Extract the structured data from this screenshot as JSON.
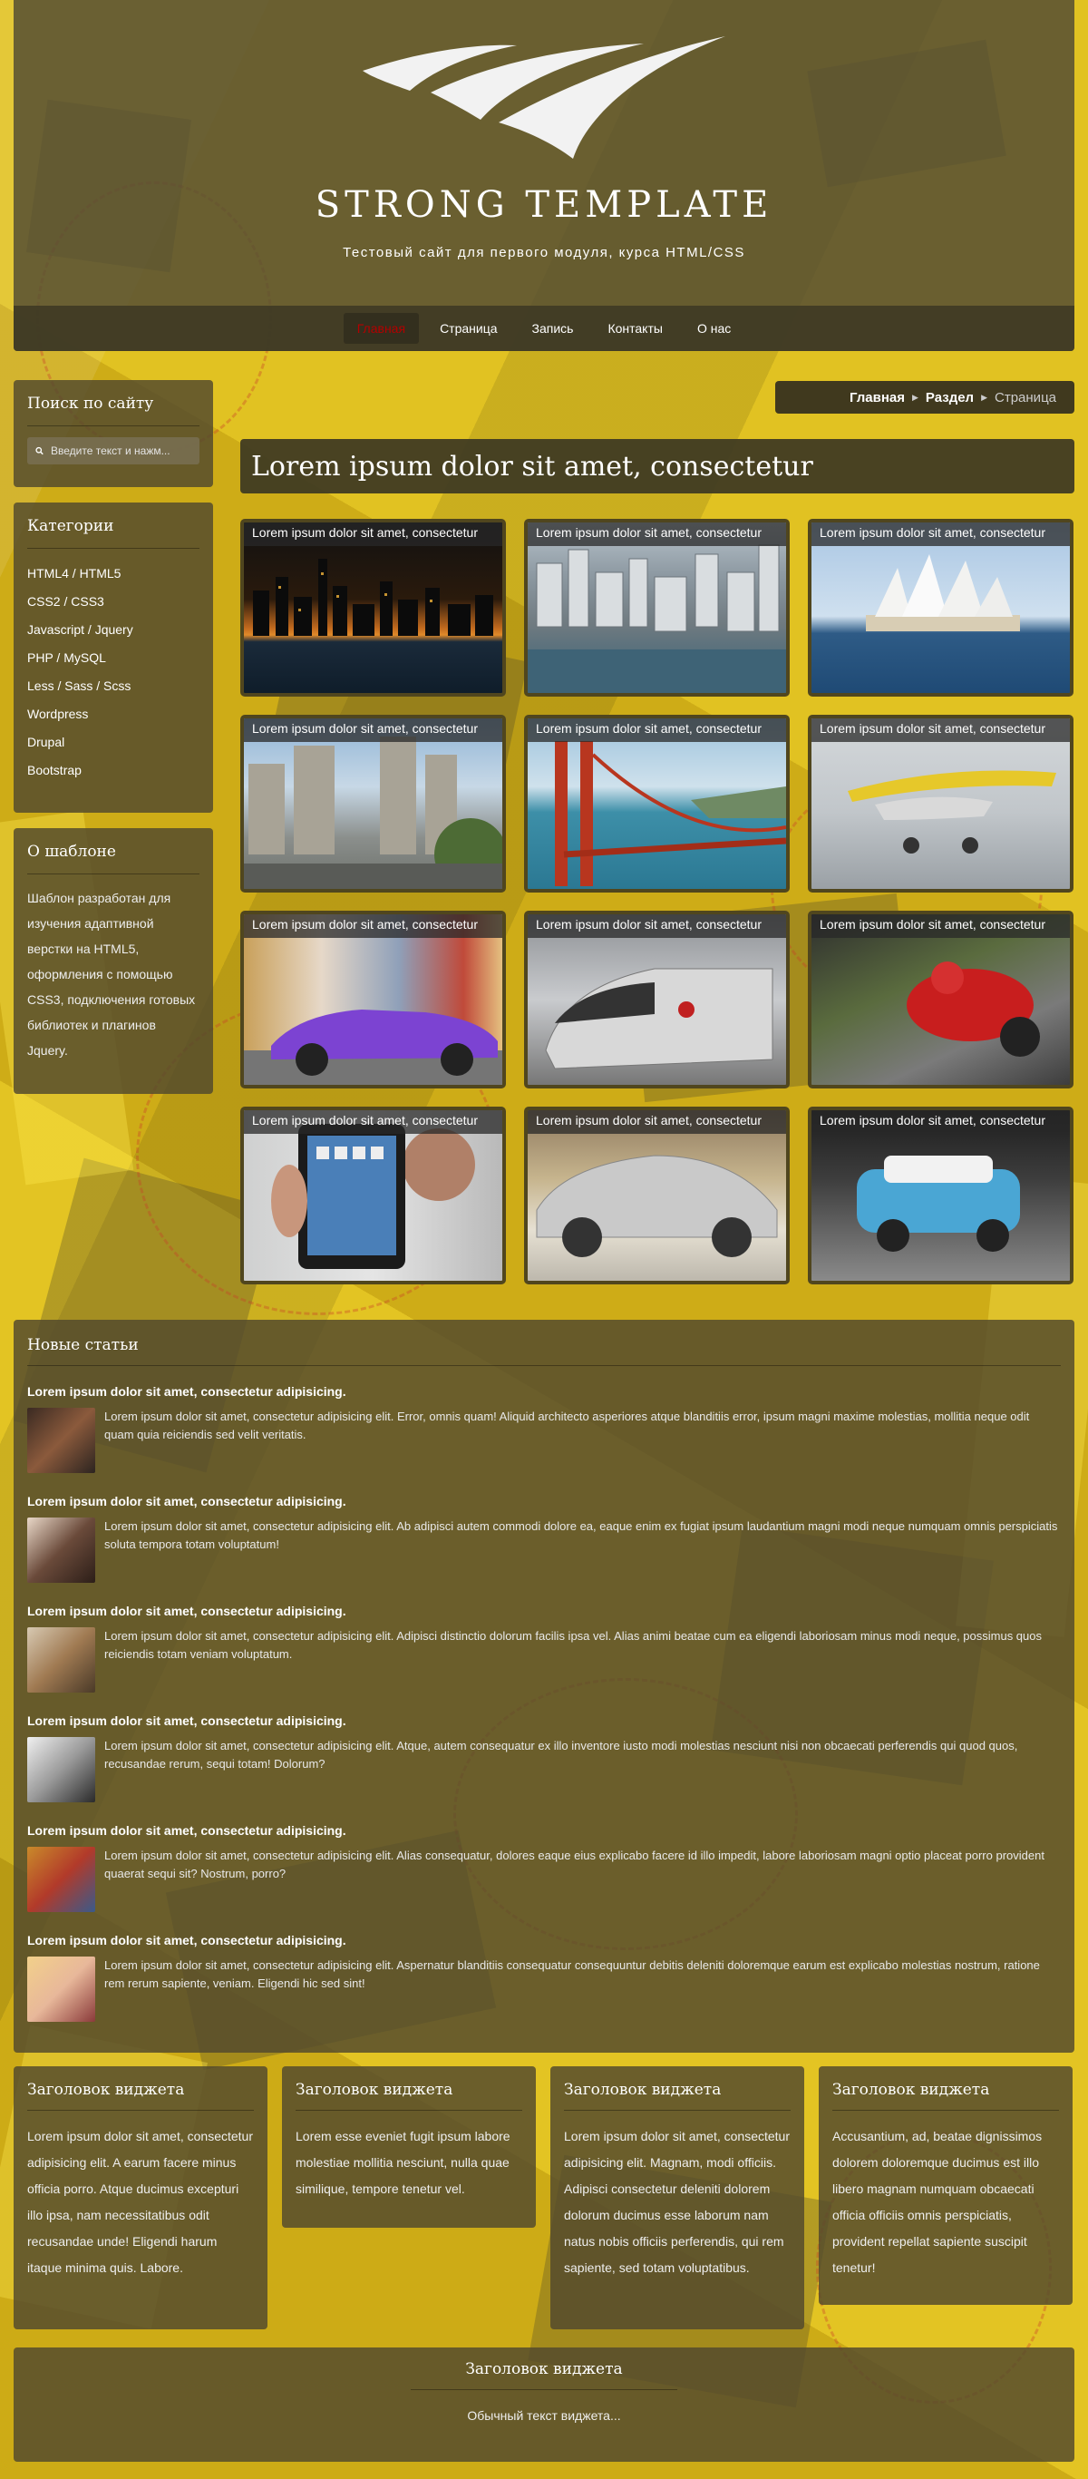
{
  "header": {
    "title": "STRONG TEMPLATE",
    "subtitle": "Тестовый сайт для первого модуля, курса HTML/CSS",
    "logo_icon": "wings-logo-icon"
  },
  "nav": {
    "items": [
      {
        "label": "Главная",
        "active": true
      },
      {
        "label": "Страница",
        "active": false
      },
      {
        "label": "Запись",
        "active": false
      },
      {
        "label": "Контакты",
        "active": false
      },
      {
        "label": "О нас",
        "active": false
      }
    ]
  },
  "breadcrumb": {
    "home": "Главная",
    "section": "Раздел",
    "current": "Страница"
  },
  "sidebar": {
    "search": {
      "title": "Поиск по сайту",
      "placeholder": "Введите текст и нажм..."
    },
    "categories": {
      "title": "Категории",
      "items": [
        "HTML4 / HTML5",
        "CSS2 / CSS3",
        "Javascript / Jquery",
        "PHP / MySQL",
        "Less / Sass / Scss",
        "Wordpress",
        "Drupal",
        "Bootstrap"
      ]
    },
    "about": {
      "title": "О шаблоне",
      "text": "Шаблон разработан для изучения адаптивной верстки на HTML5, оформления с помощью CSS3, подключения готовых библиотек и плагинов Jquery."
    }
  },
  "main": {
    "title": "Lorem ipsum dolor sit amet, consectetur",
    "gallery": [
      {
        "caption": "Lorem ipsum dolor sit amet, consectetur",
        "image": "city-night-skyline"
      },
      {
        "caption": "Lorem ipsum dolor sit amet, consectetur",
        "image": "city-aerial"
      },
      {
        "caption": "Lorem ipsum dolor sit amet, consectetur",
        "image": "sydney-opera-house"
      },
      {
        "caption": "Lorem ipsum dolor sit amet, consectetur",
        "image": "city-street"
      },
      {
        "caption": "Lorem ipsum dolor sit amet, consectetur",
        "image": "golden-gate-bridge"
      },
      {
        "caption": "Lorem ipsum dolor sit amet, consectetur",
        "image": "yellow-airplane"
      },
      {
        "caption": "Lorem ipsum dolor sit amet, consectetur",
        "image": "purple-sports-car"
      },
      {
        "caption": "Lorem ipsum dolor sit amet, consectetur",
        "image": "high-speed-train"
      },
      {
        "caption": "Lorem ipsum dolor sit amet, consectetur",
        "image": "motorcycle-racer"
      },
      {
        "caption": "Lorem ipsum dolor sit amet, consectetur",
        "image": "man-with-tablet"
      },
      {
        "caption": "Lorem ipsum dolor sit amet, consectetur",
        "image": "silver-porsche"
      },
      {
        "caption": "Lorem ipsum dolor sit amet, consectetur",
        "image": "blue-mini-cooper"
      }
    ]
  },
  "articles": {
    "title": "Новые статьи",
    "items": [
      {
        "title": "Lorem ipsum dolor sit amet, consectetur adipisicing.",
        "text": "Lorem ipsum dolor sit amet, consectetur adipisicing elit. Error, omnis quam! Aliquid architecto asperiores atque blanditiis error, ipsum magni maxime molestias, mollitia neque odit quam quia reiciendis sed velit veritatis."
      },
      {
        "title": "Lorem ipsum dolor sit amet, consectetur adipisicing.",
        "text": "Lorem ipsum dolor sit amet, consectetur adipisicing elit. Ab adipisci autem commodi dolore ea, eaque enim ex fugiat ipsum laudantium magni modi neque numquam omnis perspiciatis soluta tempora totam voluptatum!"
      },
      {
        "title": "Lorem ipsum dolor sit amet, consectetur adipisicing.",
        "text": "Lorem ipsum dolor sit amet, consectetur adipisicing elit. Adipisci distinctio dolorum facilis ipsa vel. Alias animi beatae cum ea eligendi laboriosam minus modi neque, possimus quos reiciendis totam veniam voluptatum."
      },
      {
        "title": "Lorem ipsum dolor sit amet, consectetur adipisicing.",
        "text": "Lorem ipsum dolor sit amet, consectetur adipisicing elit. Atque, autem consequatur ex illo inventore iusto modi molestias nesciunt nisi non obcaecati perferendis qui quod quos, recusandae rerum, sequi totam! Dolorum?"
      },
      {
        "title": "Lorem ipsum dolor sit amet, consectetur adipisicing.",
        "text": "Lorem ipsum dolor sit amet, consectetur adipisicing elit. Alias consequatur, dolores eaque eius explicabo facere id illo impedit, labore laboriosam magni optio placeat porro provident quaerat sequi sit? Nostrum, porro?"
      },
      {
        "title": "Lorem ipsum dolor sit amet, consectetur adipisicing.",
        "text": "Lorem ipsum dolor sit amet, consectetur adipisicing elit. Aspernatur blanditiis consequatur consequuntur debitis deleniti doloremque earum est explicabo molestias nostrum, ratione rem rerum sapiente, veniam. Eligendi hic sed sint!"
      }
    ]
  },
  "widgets": [
    {
      "title": "Заголовок виджета",
      "text": "Lorem ipsum dolor sit amet, consectetur adipisicing elit. A earum facere minus officia porro. Atque ducimus excepturi illo ipsa, nam necessitatibus odit recusandae unde! Eligendi harum itaque minima quis. Labore."
    },
    {
      "title": "Заголовок виджета",
      "text": "Lorem esse eveniet fugit ipsum labore molestiae mollitia nesciunt, nulla quae similique, tempore tenetur vel."
    },
    {
      "title": "Заголовок виджета",
      "text": "Lorem ipsum dolor sit amet, consectetur adipisicing elit. Magnam, modi officiis. Adipisci consectetur deleniti dolorem dolorum ducimus esse laborum nam natus nobis officiis perferendis, qui rem sapiente, sed totam voluptatibus."
    },
    {
      "title": "Заголовок виджета",
      "text": "Accusantium, ad, beatae dignissimos dolorem doloremque ducimus est illo libero magnam numquam obcaecati officia officiis omnis perspiciatis, provident repellat sapiente suscipit tenetur!"
    }
  ],
  "footer": {
    "title": "Заголовок виджета",
    "text": "Обычный текст виджета..."
  },
  "colors": {
    "background": "#dcbc1d",
    "panel": "#50482d",
    "nav_active": "#b30000"
  }
}
